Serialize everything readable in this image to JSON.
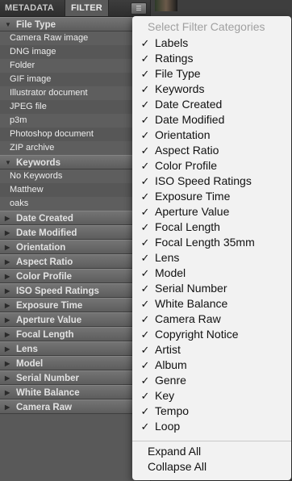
{
  "tabs": {
    "metadata": "METADATA",
    "filter": "FILTER",
    "menu_icon": "panel-menu-icon"
  },
  "filter_panel": {
    "sections": [
      {
        "title": "File Type",
        "expanded": true,
        "items": [
          "Camera Raw image",
          "DNG image",
          "Folder",
          "GIF image",
          "Illustrator document",
          "JPEG file",
          "p3m",
          "Photoshop document",
          "ZIP archive"
        ]
      },
      {
        "title": "Keywords",
        "expanded": true,
        "items": [
          "No Keywords",
          "Matthew",
          "oaks"
        ]
      },
      {
        "title": "Date Created",
        "expanded": false,
        "items": []
      },
      {
        "title": "Date Modified",
        "expanded": false,
        "items": []
      },
      {
        "title": "Orientation",
        "expanded": false,
        "items": []
      },
      {
        "title": "Aspect Ratio",
        "expanded": false,
        "items": []
      },
      {
        "title": "Color Profile",
        "expanded": false,
        "items": []
      },
      {
        "title": "ISO Speed Ratings",
        "expanded": false,
        "items": []
      },
      {
        "title": "Exposure Time",
        "expanded": false,
        "items": []
      },
      {
        "title": "Aperture Value",
        "expanded": false,
        "items": []
      },
      {
        "title": "Focal Length",
        "expanded": false,
        "items": []
      },
      {
        "title": "Lens",
        "expanded": false,
        "items": []
      },
      {
        "title": "Model",
        "expanded": false,
        "items": []
      },
      {
        "title": "Serial Number",
        "expanded": false,
        "items": []
      },
      {
        "title": "White Balance",
        "expanded": false,
        "items": []
      },
      {
        "title": "Camera Raw",
        "expanded": false,
        "items": []
      }
    ]
  },
  "popup_menu": {
    "header": "Select Filter Categories",
    "items": [
      {
        "label": "Labels",
        "checked": true
      },
      {
        "label": "Ratings",
        "checked": true
      },
      {
        "label": "File Type",
        "checked": true
      },
      {
        "label": "Keywords",
        "checked": true
      },
      {
        "label": "Date Created",
        "checked": true
      },
      {
        "label": "Date Modified",
        "checked": true
      },
      {
        "label": "Orientation",
        "checked": true
      },
      {
        "label": "Aspect Ratio",
        "checked": true
      },
      {
        "label": "Color Profile",
        "checked": true
      },
      {
        "label": "ISO Speed Ratings",
        "checked": true
      },
      {
        "label": "Exposure Time",
        "checked": true
      },
      {
        "label": "Aperture Value",
        "checked": true
      },
      {
        "label": "Focal Length",
        "checked": true
      },
      {
        "label": "Focal Length 35mm",
        "checked": true
      },
      {
        "label": "Lens",
        "checked": true
      },
      {
        "label": "Model",
        "checked": true
      },
      {
        "label": "Serial Number",
        "checked": true
      },
      {
        "label": "White Balance",
        "checked": true
      },
      {
        "label": "Camera Raw",
        "checked": true
      },
      {
        "label": "Copyright Notice",
        "checked": true
      },
      {
        "label": "Artist",
        "checked": true
      },
      {
        "label": "Album",
        "checked": true
      },
      {
        "label": "Genre",
        "checked": true
      },
      {
        "label": "Key",
        "checked": true
      },
      {
        "label": "Tempo",
        "checked": true
      },
      {
        "label": "Loop",
        "checked": true
      }
    ],
    "actions": [
      "Expand All",
      "Collapse All"
    ]
  }
}
